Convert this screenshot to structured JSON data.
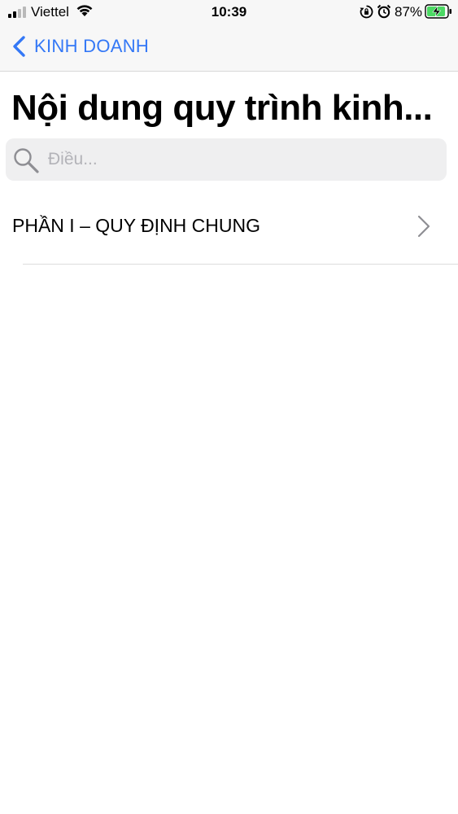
{
  "status_bar": {
    "carrier": "Viettel",
    "time": "10:39",
    "battery_percent": "87%",
    "signal_bars": 2,
    "charging": true
  },
  "nav": {
    "back_label": "KINH DOANH"
  },
  "page": {
    "title": "Nội dung quy trình kinh..."
  },
  "search": {
    "placeholder": "Điều..."
  },
  "list": {
    "items": [
      {
        "label": "PHẦN I – QUY ĐỊNH CHUNG"
      }
    ]
  },
  "colors": {
    "accent": "#3478f6",
    "battery_green": "#4cd964",
    "separator": "#dcdcdc",
    "search_bg": "#efeff0"
  },
  "icons": {
    "back": "chevron-left-icon",
    "search": "magnifier-icon",
    "disclosure": "chevron-right-icon"
  }
}
